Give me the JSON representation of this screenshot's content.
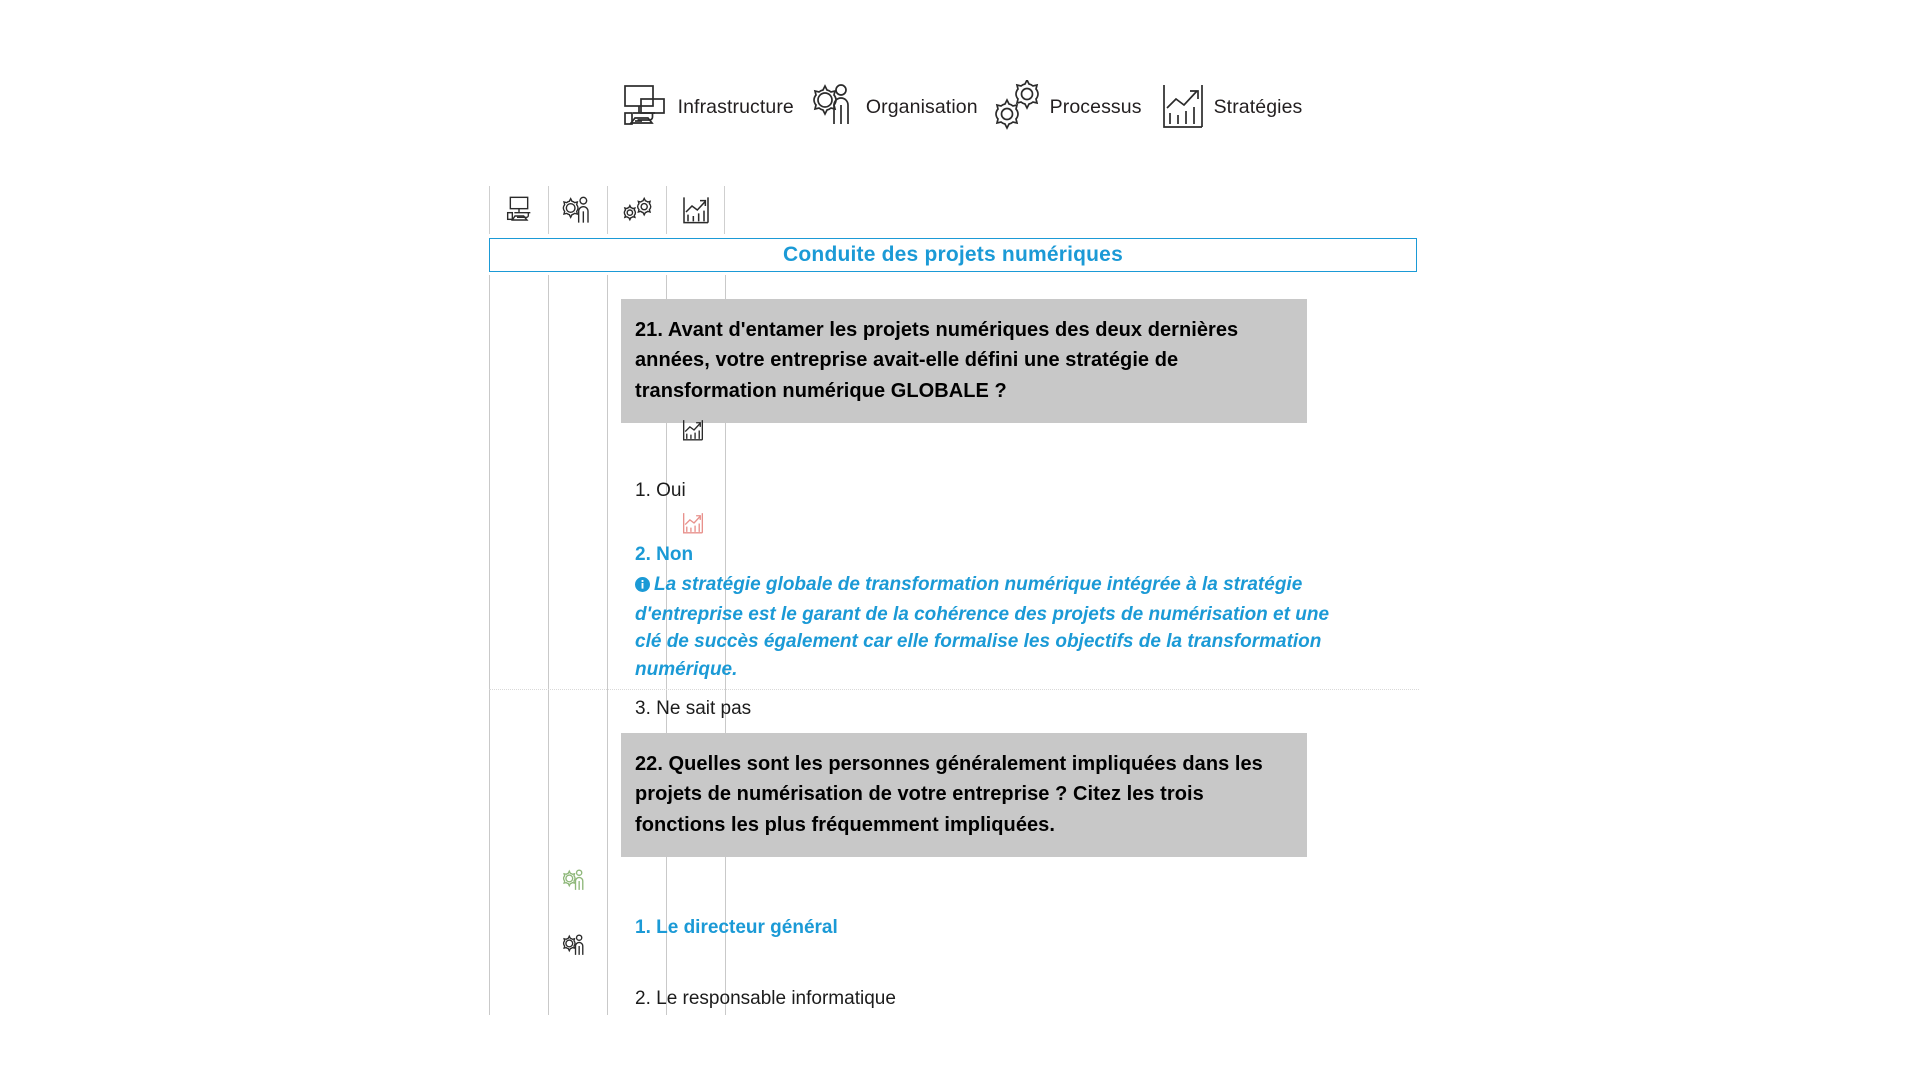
{
  "legend": {
    "items": [
      {
        "label": "Infrastructure",
        "icon": "infrastructure-icon"
      },
      {
        "label": "Organisation",
        "icon": "organisation-icon"
      },
      {
        "label": "Processus",
        "icon": "processus-icon"
      },
      {
        "label": "Stratégies",
        "icon": "strategies-icon"
      }
    ]
  },
  "column_headers": [
    {
      "icon": "infrastructure-icon"
    },
    {
      "icon": "organisation-icon"
    },
    {
      "icon": "processus-icon"
    },
    {
      "icon": "strategies-icon"
    }
  ],
  "banner": {
    "title": "Conduite des projets numériques"
  },
  "colors": {
    "accent_blue": "#1b9ad6",
    "question_bg": "#c8c8c8",
    "icon_green": "#8fb87a",
    "icon_red": "#e8918c",
    "icon_dark": "#2b2b2b",
    "grid_line": "#c9c9c9"
  },
  "questions": [
    {
      "number": "21.",
      "text": "21. Avant d'entamer les projets numériques des deux dernières années, votre entreprise avait-elle défini une stratégie de transformation numérique GLOBALE ?",
      "answers": [
        {
          "label": "1. Oui",
          "selected": false,
          "gutter_icon": "strategies-icon",
          "gutter_icon_color": "dark",
          "gutter_column": 4
        },
        {
          "label": "2. Non",
          "selected": true,
          "gutter_icon": "strategies-icon",
          "gutter_icon_color": "red",
          "gutter_column": 4,
          "info": "La stratégie globale de transformation numérique intégrée à la stratégie d'entreprise est le garant de la cohérence des projets de numérisation et une clé de succès également car elle formalise les objectifs de la transformation numérique."
        },
        {
          "label": "3. Ne sait pas",
          "selected": false
        }
      ]
    },
    {
      "number": "22.",
      "text": "22. Quelles sont les personnes généralement impliquées dans les projets de numérisation de votre entreprise ? Citez les trois fonctions les plus fréquemment impliquées.",
      "answers": [
        {
          "label": "1. Le directeur général",
          "selected": true,
          "gutter_icon": "organisation-icon",
          "gutter_icon_color": "green",
          "gutter_column": 2
        },
        {
          "label": "2. Le responsable informatique",
          "selected": false,
          "gutter_icon": "organisation-icon",
          "gutter_icon_color": "dark",
          "gutter_column": 2
        }
      ]
    }
  ]
}
